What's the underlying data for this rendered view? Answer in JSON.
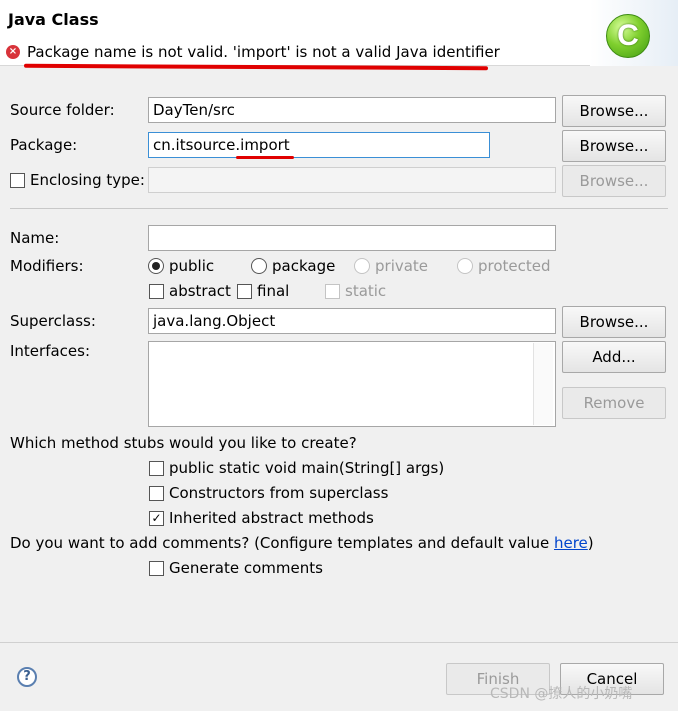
{
  "header": {
    "title": "Java Class",
    "error_message": "Package name is not valid. 'import' is not a valid Java identifier",
    "logo_letter": "C"
  },
  "form": {
    "source_folder": {
      "label": "Source folder:",
      "value": "DayTen/src",
      "button": "Browse..."
    },
    "package": {
      "label": "Package:",
      "value_prefix": "cn.itsource.",
      "value_suffix": "import",
      "button": "Browse..."
    },
    "enclosing_type": {
      "label": "Enclosing type:",
      "value": "",
      "button": "Browse...",
      "checked": false
    },
    "name": {
      "label": "Name:",
      "value": ""
    },
    "modifiers": {
      "label": "Modifiers:",
      "access": [
        {
          "label": "public",
          "selected": true,
          "enabled": true
        },
        {
          "label": "package",
          "selected": false,
          "enabled": true
        },
        {
          "label": "private",
          "selected": false,
          "enabled": false
        },
        {
          "label": "protected",
          "selected": false,
          "enabled": false
        }
      ],
      "flags": [
        {
          "label": "abstract",
          "checked": false,
          "enabled": true
        },
        {
          "label": "final",
          "checked": false,
          "enabled": true
        },
        {
          "label": "static",
          "checked": false,
          "enabled": false
        }
      ]
    },
    "superclass": {
      "label": "Superclass:",
      "value": "java.lang.Object",
      "button": "Browse..."
    },
    "interfaces": {
      "label": "Interfaces:",
      "add_button": "Add...",
      "remove_button": "Remove"
    },
    "stubs": {
      "question": "Which method stubs would you like to create?",
      "options": [
        {
          "label": "public static void main(String[] args)",
          "checked": false
        },
        {
          "label": "Constructors from superclass",
          "checked": false
        },
        {
          "label": "Inherited abstract methods",
          "checked": true
        }
      ]
    },
    "comments": {
      "question_prefix": "Do you want to add comments? (Configure templates and default value ",
      "link": "here",
      "question_suffix": ")",
      "option": {
        "label": "Generate comments",
        "checked": false
      }
    }
  },
  "footer": {
    "help": "?",
    "finish": "Finish",
    "cancel": "Cancel",
    "watermark": "CSDN @撩人的小奶嘴"
  },
  "colors": {
    "error": "#d8333a",
    "annotation_red": "#e00000",
    "link": "#0044cc",
    "focus": "#3a8fd6"
  }
}
